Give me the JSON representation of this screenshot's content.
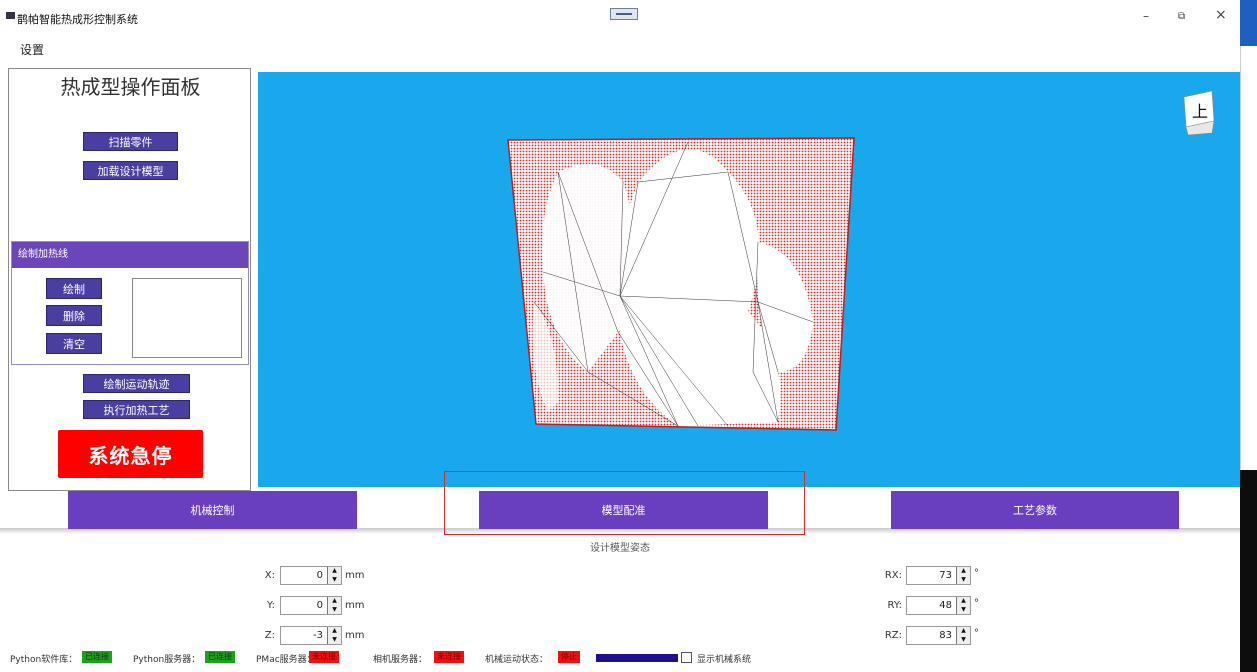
{
  "window": {
    "title": "鹊帕智能热成形控制系统",
    "controls": {
      "minimize": "–",
      "restore": "⧉",
      "close": "×"
    }
  },
  "menu": {
    "settings": "设置"
  },
  "left_panel": {
    "title": "热成型操作面板",
    "scan_button": "扫描零件",
    "load_model_button": "加载设计模型",
    "heating_group": {
      "header": "绘制加热线",
      "draw_button": "绘制",
      "delete_button": "删除",
      "clear_button": "清空"
    },
    "draw_trajectory_button": "绘制运动轨迹",
    "execute_heating_button": "执行加热工艺",
    "emergency_stop": "系统急停"
  },
  "tabs": [
    {
      "label": "机械控制"
    },
    {
      "label": "模型配准"
    },
    {
      "label": "工艺参数"
    }
  ],
  "pose": {
    "title": "设计模型姿态",
    "fields": [
      {
        "label": "X:",
        "value": "0",
        "unit": "mm"
      },
      {
        "label": "Y:",
        "value": "0",
        "unit": "mm"
      },
      {
        "label": "Z:",
        "value": "-3",
        "unit": "mm"
      },
      {
        "label": "RX:",
        "value": "73",
        "unit": "°"
      },
      {
        "label": "RY:",
        "value": "48",
        "unit": "°"
      },
      {
        "label": "RZ:",
        "value": "83",
        "unit": "°"
      }
    ]
  },
  "status": {
    "python_lib_label": "Python软件库：",
    "python_lib_value": "已连接",
    "python_server_label": "Python服务器：",
    "python_server_value": "已连接",
    "pmac_label": "PMac服务器：",
    "pmac_value": "未连接",
    "camera_label": "相机服务器：",
    "camera_value": "未连接",
    "motion_label": "机械运动状态：",
    "motion_value": "停止",
    "show_machine_label": "显示机械系统",
    "show_machine_checked": false
  },
  "viewcube": {
    "face_text": "上"
  },
  "colors": {
    "viewport_bg": "#1aa8ec",
    "tab_purple": "#6a3fbf",
    "button_purple": "#4a3ea0",
    "estop_red": "#ff0000",
    "status_green": "#1fa01f",
    "status_red": "#ee1111"
  }
}
